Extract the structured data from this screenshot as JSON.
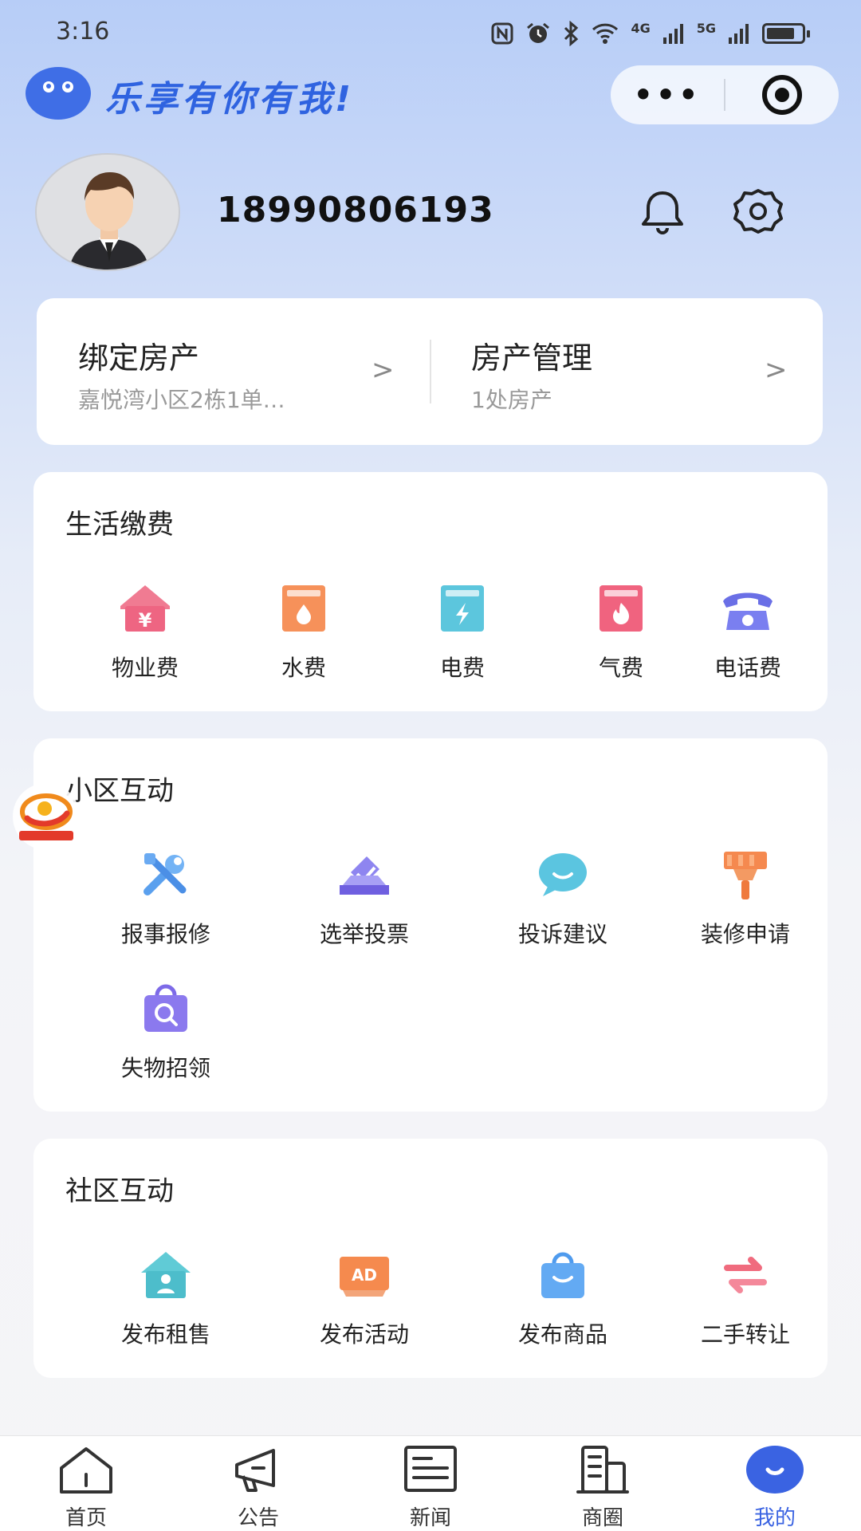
{
  "status": {
    "time": "3:16",
    "indicators": [
      "nfc-icon",
      "alarm-icon",
      "bluetooth-icon",
      "wifi-icon",
      "4g-signal-icon",
      "5g-signal-icon",
      "battery-icon"
    ],
    "net1": "4G",
    "net2": "5G"
  },
  "brand": {
    "slogan": "乐享有你有我!"
  },
  "capsule": {
    "more": "•••"
  },
  "profile": {
    "phone": "18990806193"
  },
  "property": {
    "bind_title": "绑定房产",
    "bind_sub": "嘉悦湾小区2栋1单…",
    "manage_title": "房产管理",
    "manage_sub": "1处房产",
    "arrow": ">"
  },
  "life_pay": {
    "title": "生活缴费",
    "items": [
      {
        "label": "物业费",
        "icon": "property-fee-icon"
      },
      {
        "label": "水费",
        "icon": "water-fee-icon"
      },
      {
        "label": "电费",
        "icon": "electric-fee-icon"
      },
      {
        "label": "气费",
        "icon": "gas-fee-icon"
      },
      {
        "label": "电话费",
        "icon": "phone-fee-icon"
      }
    ]
  },
  "estate_interact": {
    "title": "小区互动",
    "items": [
      {
        "label": "报事报修",
        "icon": "repair-tools-icon"
      },
      {
        "label": "选举投票",
        "icon": "vote-icon"
      },
      {
        "label": "投诉建议",
        "icon": "chat-bubble-icon"
      },
      {
        "label": "装修申请",
        "icon": "paint-brush-icon"
      },
      {
        "label": "失物招领",
        "icon": "lost-found-bag-icon"
      }
    ]
  },
  "community_interact": {
    "title": "社区互动",
    "items": [
      {
        "label": "发布租售",
        "icon": "house-rent-icon"
      },
      {
        "label": "发布活动",
        "icon": "ad-icon"
      },
      {
        "label": "发布商品",
        "icon": "shopping-bag-icon"
      },
      {
        "label": "二手转让",
        "icon": "exchange-arrows-icon"
      }
    ]
  },
  "tabs": [
    {
      "label": "首页",
      "icon": "home-icon"
    },
    {
      "label": "公告",
      "icon": "megaphone-icon"
    },
    {
      "label": "新闻",
      "icon": "news-icon"
    },
    {
      "label": "商圈",
      "icon": "building-icon"
    },
    {
      "label": "我的",
      "icon": "profile-smile-icon",
      "active": true
    }
  ],
  "colors": {
    "accent": "#3a63e2",
    "brand": "#2f63e0"
  }
}
